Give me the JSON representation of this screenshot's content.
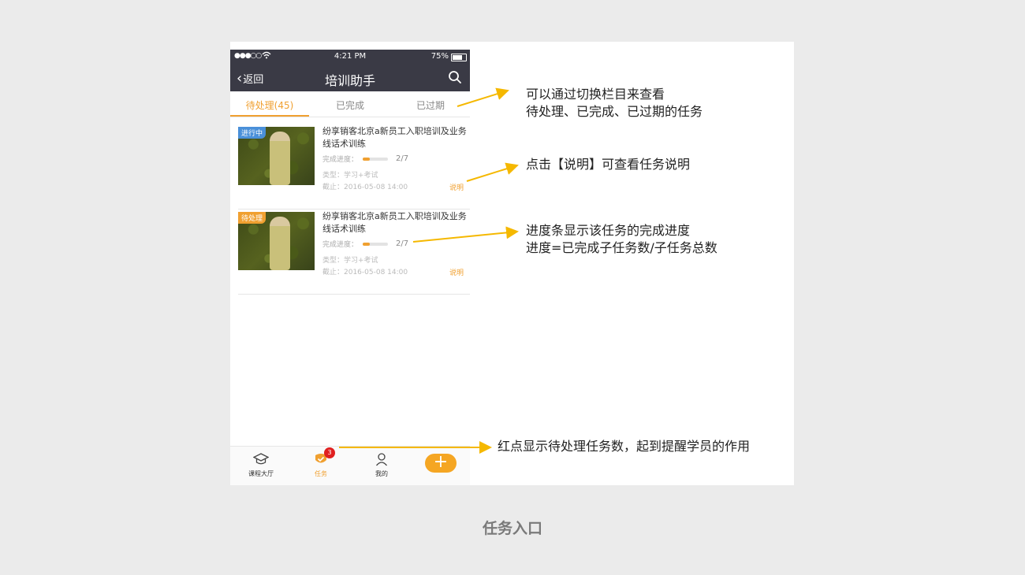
{
  "statusbar": {
    "signal": "●●●○○",
    "time": "4:21 PM",
    "battery": "75%",
    "battery_level": 0.75
  },
  "navbar": {
    "back_label": "返回",
    "title": "培训助手"
  },
  "tabs": [
    {
      "label": "待处理(45)",
      "active": true
    },
    {
      "label": "已完成",
      "active": false
    },
    {
      "label": "已过期",
      "active": false
    }
  ],
  "cards": [
    {
      "badge": "进行中",
      "badge_color": "#4a90d9",
      "title": "纷享销客北京a新员工入职培训及业务线话术训练",
      "progress_label": "完成进度：",
      "progress_count": "2/7",
      "progress_fraction": 0.2857,
      "type": "类型：学习+考试",
      "deadline": "截止：2016-05-08 14:00",
      "explain": "说明"
    },
    {
      "badge": "待处理",
      "badge_color": "#f0a030",
      "title": "纷享销客北京a新员工入职培训及业务线话术训练",
      "progress_label": "完成进度：",
      "progress_count": "2/7",
      "progress_fraction": 0.2857,
      "type": "类型：学习+考试",
      "deadline": "截止：2016-05-08 14:00",
      "explain": "说明"
    }
  ],
  "tabbar": [
    {
      "label": "课程大厅",
      "icon": "graduation-cap-icon"
    },
    {
      "label": "任务",
      "icon": "task-check-icon",
      "badge": "3",
      "active": true
    },
    {
      "label": "我的",
      "icon": "person-icon"
    },
    {
      "label": "+",
      "icon": "plus-icon"
    }
  ],
  "annotations": {
    "tabs_line1": "可以通过切换栏目来查看",
    "tabs_line2": "待处理、已完成、已过期的任务",
    "explain": "点击【说明】可查看任务说明",
    "progress_line1": "进度条显示该任务的完成进度",
    "progress_line2": "进度=已完成子任务数/子任务总数",
    "reddot": "红点显示待处理任务数，起到提醒学员的作用"
  },
  "accent_color": "#f0a030",
  "arrow_color": "#f5b800",
  "caption": "任务入口"
}
